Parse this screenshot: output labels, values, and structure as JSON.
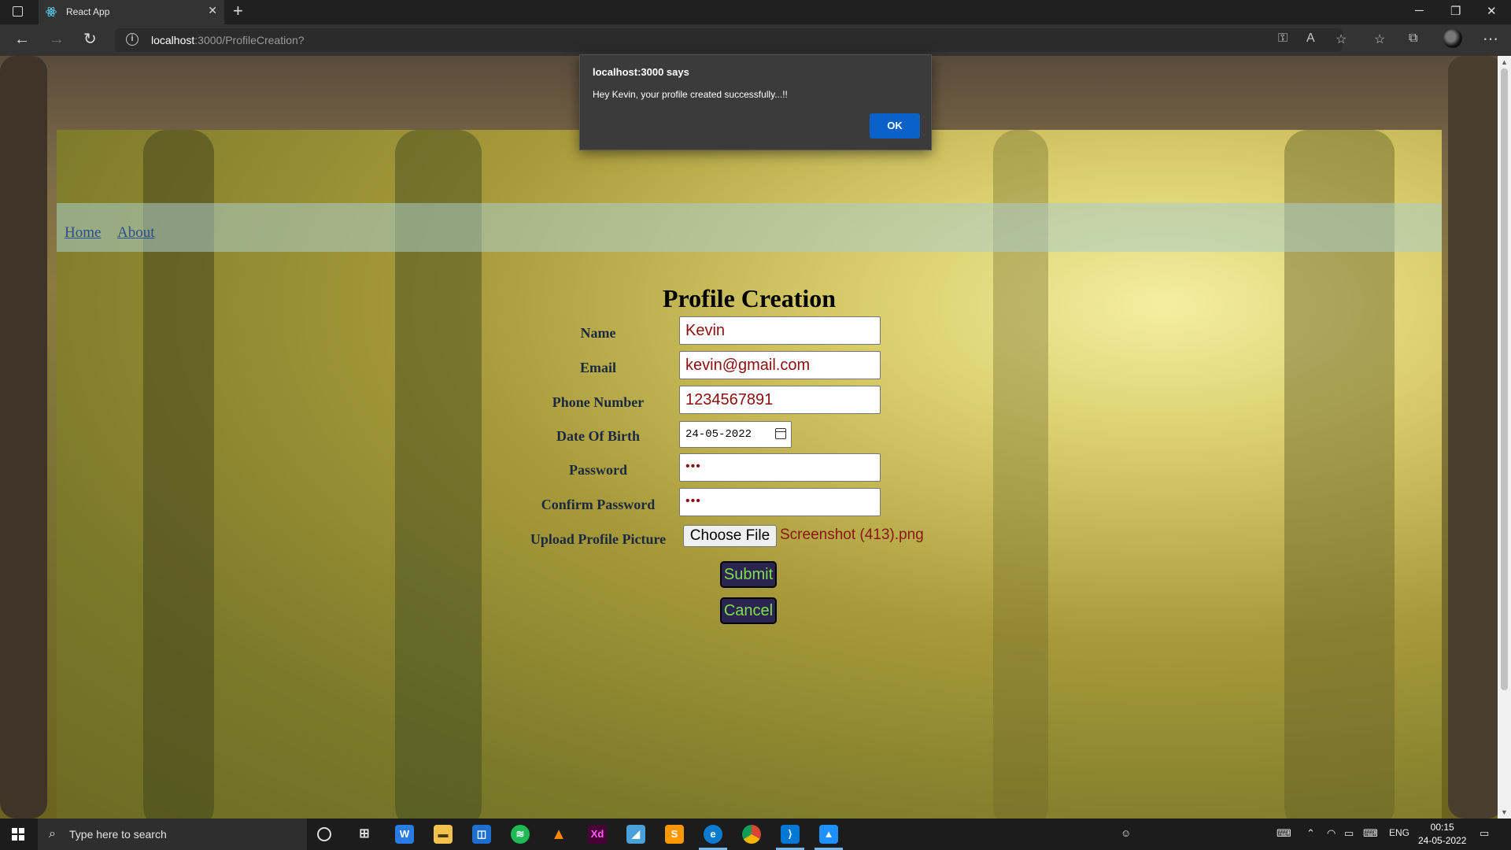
{
  "browser": {
    "tab_title": "React App",
    "url_host": "localhost",
    "url_rest": ":3000/ProfileCreation?"
  },
  "page": {
    "nav": {
      "home": "Home",
      "about": "About"
    },
    "title": "Profile Creation",
    "fields": {
      "name": {
        "label": "Name",
        "value": "Kevin"
      },
      "email": {
        "label": "Email",
        "value": "kevin@gmail.com"
      },
      "phone": {
        "label": "Phone Number",
        "value": "1234567891"
      },
      "dob": {
        "label": "Date Of Birth",
        "value": "24-05-2022"
      },
      "password": {
        "label": "Password",
        "value": "•••"
      },
      "confirm": {
        "label": "Confirm Password",
        "value": "•••"
      },
      "upload": {
        "label": "Upload Profile Picture",
        "button": "Choose File",
        "filename": "Screenshot (413).png"
      }
    },
    "submit_label": "Submit",
    "cancel_label": "Cancel"
  },
  "alert": {
    "header": "localhost:3000 says",
    "message": "Hey Kevin, your profile created successfully...!!",
    "ok_label": "OK"
  },
  "taskbar": {
    "search_placeholder": "Type here to search",
    "language": "ENG",
    "time": "00:15",
    "date": "24-05-2022"
  },
  "colors": {
    "accent": "#0a62c9",
    "button_bg": "#2b2450",
    "button_text": "#7ee04a",
    "input_text": "#8b0d0d",
    "nav_link": "#2b4e8f"
  }
}
